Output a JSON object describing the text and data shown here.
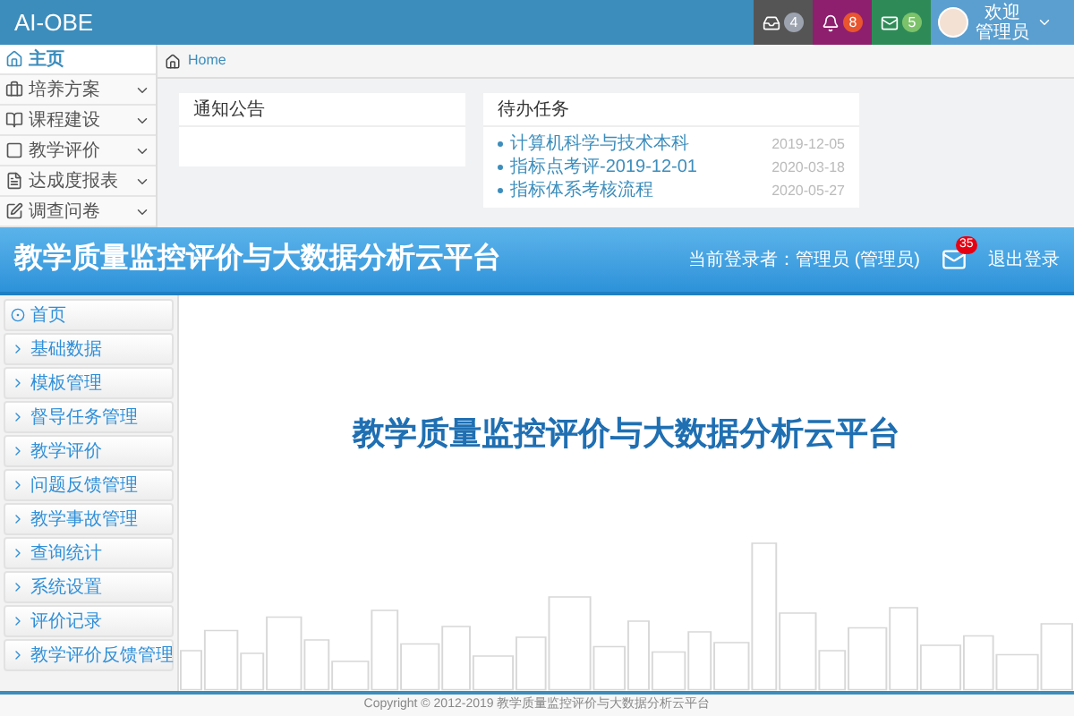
{
  "admin": {
    "brand": "AI-OBE",
    "header_buttons": [
      {
        "count": "4",
        "color": "#555555"
      },
      {
        "count": "8",
        "color": "#8e1f6e"
      },
      {
        "count": "5",
        "color": "#2e8b57"
      }
    ],
    "user": {
      "greeting": "欢迎",
      "name": "管理员"
    },
    "sidebar": {
      "items": [
        {
          "label": "主页",
          "selected": true,
          "has_submenu": false
        },
        {
          "label": "培养方案",
          "selected": false,
          "has_submenu": true
        },
        {
          "label": "课程建设",
          "selected": false,
          "has_submenu": true
        },
        {
          "label": "教学评价",
          "selected": false,
          "has_submenu": true
        },
        {
          "label": "达成度报表",
          "selected": false,
          "has_submenu": true
        },
        {
          "label": "调查问卷",
          "selected": false,
          "has_submenu": true
        }
      ]
    },
    "breadcrumb": "Home",
    "cards": [
      {
        "title": "通知公告"
      },
      {
        "title": "待办任务",
        "items": [
          {
            "title": "计算机科学与技术本科",
            "date": "2019-12-05"
          },
          {
            "title": "指标点考评-2019-12-01",
            "date": "2020-03-18"
          },
          {
            "title": "指标体系考核流程",
            "date": "2020-05-27"
          }
        ]
      }
    ]
  },
  "platform": {
    "title": "教学质量监控评价与大数据分析云平台",
    "login_info": "当前登录者：管理员 (管理员)",
    "message_count": "35",
    "logout": "退出登录",
    "menu": [
      {
        "label": "首页"
      },
      {
        "label": "基础数据"
      },
      {
        "label": "模板管理"
      },
      {
        "label": "督导任务管理"
      },
      {
        "label": "教学评价"
      },
      {
        "label": "问题反馈管理"
      },
      {
        "label": "教学事故管理"
      },
      {
        "label": "查询统计"
      },
      {
        "label": "系统设置"
      },
      {
        "label": "评价记录"
      },
      {
        "label": "教学评价反馈管理"
      }
    ],
    "banner_title": "教学质量监控评价与大数据分析云平台",
    "footer": "Copyright © 2012-2019 教学质量监控评价与大数据分析云平台"
  }
}
